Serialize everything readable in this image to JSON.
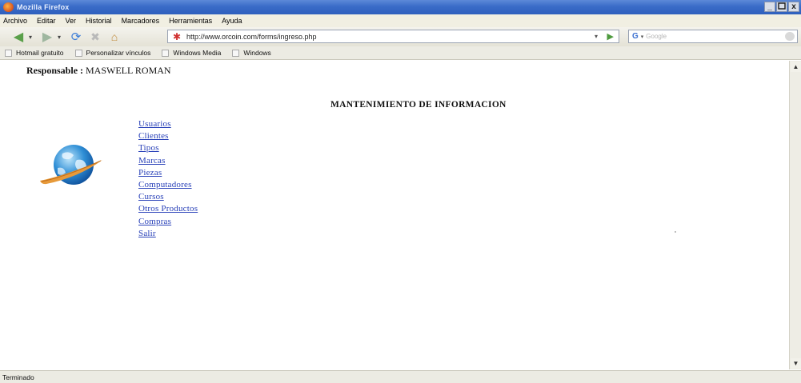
{
  "window": {
    "title": "Mozilla Firefox",
    "buttons": {
      "minimize": "_",
      "maximize": " ",
      "close": "x"
    }
  },
  "menubar": {
    "items": [
      {
        "label": "Archivo"
      },
      {
        "label": "Editar"
      },
      {
        "label": "Ver"
      },
      {
        "label": "Historial"
      },
      {
        "label": "Marcadores"
      },
      {
        "label": "Herramientas"
      },
      {
        "label": "Ayuda"
      }
    ]
  },
  "navigation": {
    "url": "http://www.orcoin.com/forms/ingreso.php",
    "search_placeholder": "Google",
    "search_engine_label": "G"
  },
  "bookmarks": [
    {
      "label": "Hotmail gratuito"
    },
    {
      "label": "Personalizar vínculos"
    },
    {
      "label": "Windows Media"
    },
    {
      "label": "Windows"
    }
  ],
  "page": {
    "responsable_label": "Responsable :",
    "responsable_name": "MASWELL ROMAN",
    "title": "MANTENIMIENTO DE INFORMACION",
    "links": [
      {
        "label": "Usuarios"
      },
      {
        "label": "Clientes"
      },
      {
        "label": "Tipos"
      },
      {
        "label": "Marcas"
      },
      {
        "label": "Piezas"
      },
      {
        "label": "Computadores"
      },
      {
        "label": "Cursos"
      },
      {
        "label": "Otros Productos"
      },
      {
        "label": "Compras"
      },
      {
        "label": "Salir"
      }
    ]
  },
  "status": {
    "text": "Terminado"
  },
  "colors": {
    "titlebar": "#3a6cc8",
    "link": "#2840b8",
    "chrome": "#ecebe3"
  }
}
